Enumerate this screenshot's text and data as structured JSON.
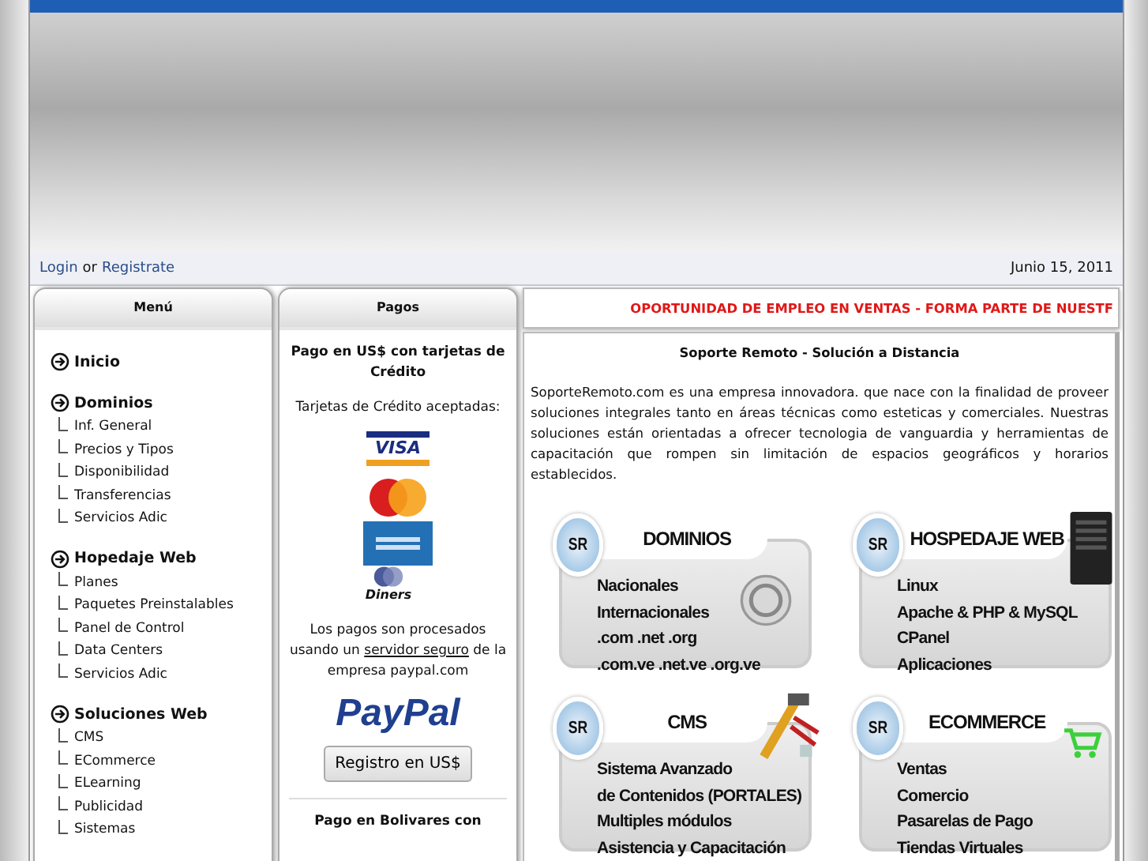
{
  "header": {
    "login_link": "Login",
    "separator": "or",
    "register_link": "Registrate",
    "date": "Junio 15, 2011"
  },
  "menu": {
    "title": "Menú",
    "sections": [
      {
        "label": "Inicio"
      },
      {
        "label": "Dominios",
        "children": [
          {
            "label": "Inf. General"
          },
          {
            "label": "Precios y Tipos"
          },
          {
            "label": "Disponibilidad"
          },
          {
            "label": "Transferencias"
          },
          {
            "label": "Servicios Adic"
          }
        ]
      },
      {
        "label": "Hopedaje Web",
        "children": [
          {
            "label": "Planes"
          },
          {
            "label": "Paquetes Preinstalables"
          },
          {
            "label": "Panel de Control"
          },
          {
            "label": "Data Centers"
          },
          {
            "label": "Servicios Adic"
          }
        ]
      },
      {
        "label": "Soluciones Web",
        "children": [
          {
            "label": "CMS"
          },
          {
            "label": "ECommerce"
          },
          {
            "label": "ELearning"
          },
          {
            "label": "Publicidad"
          },
          {
            "label": "Sistemas"
          }
        ]
      }
    ]
  },
  "payments": {
    "title": "Pagos",
    "heading": "Pago en US$ con tarjetas de Crédito",
    "accepted": "Tarjetas de Crédito aceptadas:",
    "cards": [
      {
        "kind": "visa",
        "text": "VISA"
      },
      {
        "kind": "mastercard"
      },
      {
        "kind": "amex"
      },
      {
        "kind": "diners",
        "text": "Diners"
      }
    ],
    "note_before": "Los pagos son procesados usando un",
    "note_link": "servidor seguro",
    "note_after": "de la empresa paypal.com",
    "paypal_logo": "PayPal",
    "button": "Registro en US$",
    "bolivares_heading": "Pago en Bolivares con"
  },
  "ticker": "OPORTUNIDAD DE EMPLEO EN VENTAS - FORMA PARTE DE NUESTF",
  "main": {
    "title": "Soporte Remoto - Solución a Distancia",
    "intro": "SoporteRemoto.com es una empresa innovadora. que nace con la finalidad de proveer soluciones integrales tanto en áreas técnicas como esteticas y comerciales. Nuestras soluciones están orientadas a ofrecer tecnologia de vanguardia y herramientas de capacitación que rompen sin limitación de espacios geográficos y horarios establecidos.",
    "services": [
      {
        "kind": "coin",
        "badge": "SR",
        "title": "DOMINIOS",
        "items": [
          "Nacionales",
          "Internacionales",
          ".com .net .org",
          ".com.ve .net.ve .org.ve"
        ]
      },
      {
        "kind": "server",
        "badge": "SR",
        "title": "HOSPEDAJE WEB",
        "items": [
          "Linux",
          "Apache & PHP & MySQL",
          "CPanel",
          "Aplicaciones"
        ]
      },
      {
        "kind": "tools",
        "badge": "SR",
        "title": "CMS",
        "items": [
          "Sistema Avanzado",
          "de Contenidos (PORTALES)",
          "Multiples módulos",
          "Asistencia y Capacitación"
        ]
      },
      {
        "kind": "cart",
        "badge": "SR",
        "title": "ECOMMERCE",
        "items": [
          "Ventas",
          "Comercio",
          "Pasarelas de Pago",
          "Tiendas Virtuales"
        ]
      }
    ]
  }
}
